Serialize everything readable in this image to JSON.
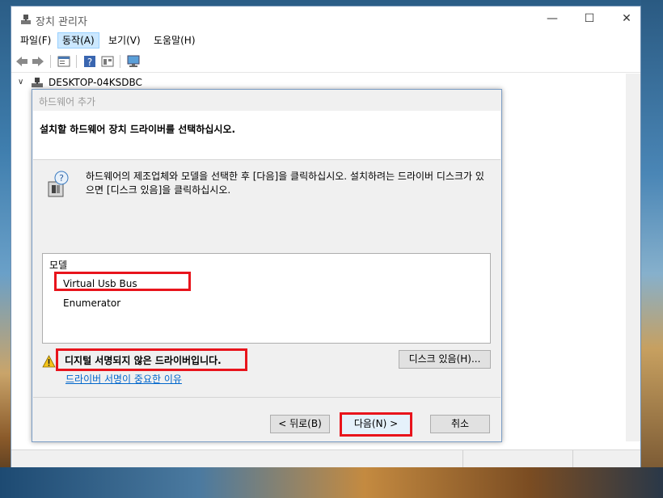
{
  "window": {
    "title": "장치 관리자",
    "menu": [
      {
        "label": "파일(F)"
      },
      {
        "label": "동작(A)"
      },
      {
        "label": "보기(V)"
      },
      {
        "label": "도움말(H)"
      }
    ],
    "tree_root": "DESKTOP-04KSDBC"
  },
  "dialog": {
    "title": "하드웨어 추가",
    "heading": "설치할 하드웨어 장치 드라이버를 선택하십시오.",
    "description": "하드웨어의 제조업체와 모델을 선택한 후 [다음]을 클릭하십시오. 설치하려는 드라이버 디스크가 있으면 [디스크 있음]을 클릭하십시오.",
    "list_header": "모델",
    "model_item": "Virtual Usb Bus Enumerator",
    "warning": "디지털 서명되지 않은 드라이버입니다.",
    "warning_link": "드라이버 서명이 중요한 이유",
    "have_disk_button": "디스크 있음(H)...",
    "back_button": "< 뒤로(B)",
    "next_button": "다음(N) >",
    "cancel_button": "취소"
  },
  "colors": {
    "highlight_box": "#e8141c",
    "link": "#0066cc",
    "menu_active_bg": "#cce8ff"
  }
}
